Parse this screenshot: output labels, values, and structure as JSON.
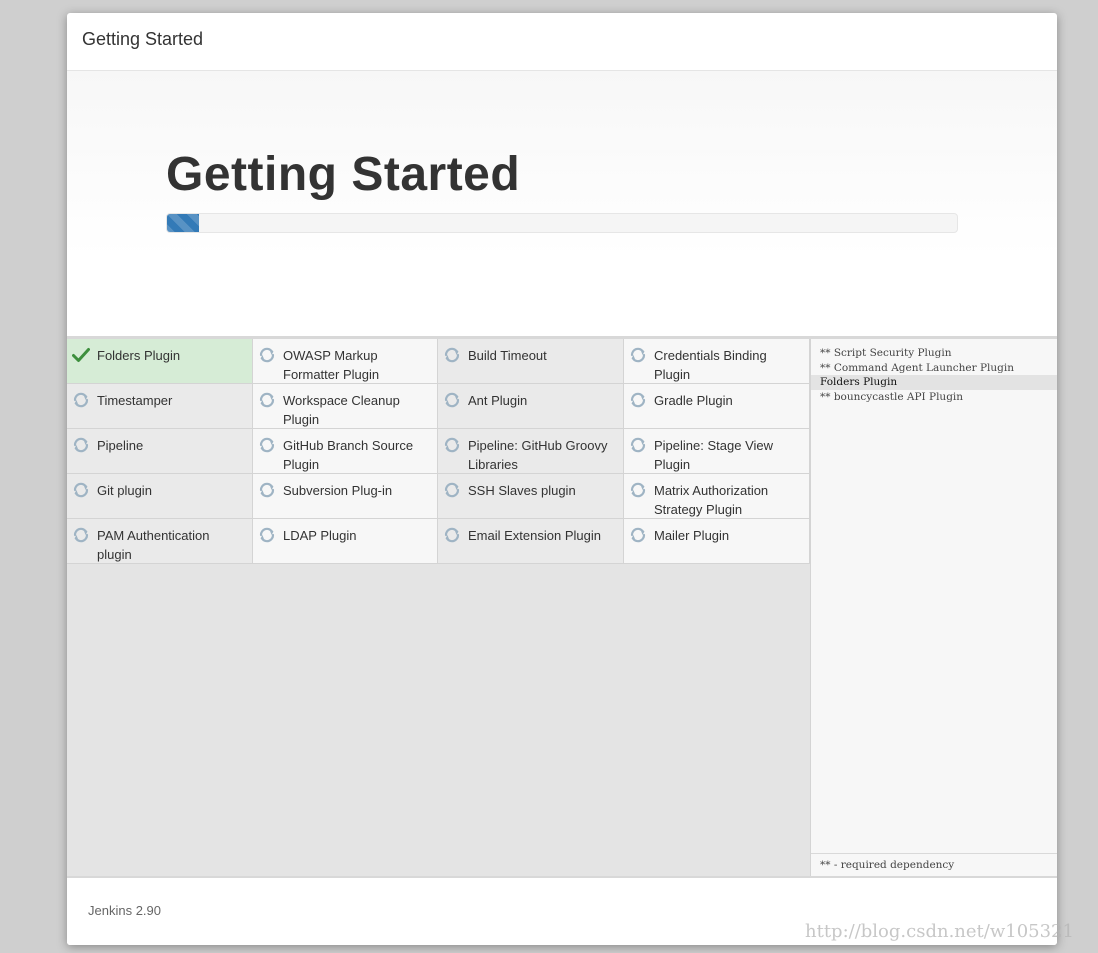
{
  "header": {
    "title": "Getting Started"
  },
  "hero": {
    "title": "Getting Started",
    "progress_percent": 4
  },
  "plugins": [
    {
      "name": "Folders Plugin",
      "status": "success"
    },
    {
      "name": "OWASP Markup Formatter Plugin",
      "status": "pending"
    },
    {
      "name": "Build Timeout",
      "status": "pending"
    },
    {
      "name": "Credentials Binding Plugin",
      "status": "pending"
    },
    {
      "name": "Timestamper",
      "status": "pending"
    },
    {
      "name": "Workspace Cleanup Plugin",
      "status": "pending"
    },
    {
      "name": "Ant Plugin",
      "status": "pending"
    },
    {
      "name": "Gradle Plugin",
      "status": "pending"
    },
    {
      "name": "Pipeline",
      "status": "pending"
    },
    {
      "name": "GitHub Branch Source Plugin",
      "status": "pending"
    },
    {
      "name": "Pipeline: GitHub Groovy Libraries",
      "status": "pending"
    },
    {
      "name": "Pipeline: Stage View Plugin",
      "status": "pending"
    },
    {
      "name": "Git plugin",
      "status": "pending"
    },
    {
      "name": "Subversion Plug-in",
      "status": "pending"
    },
    {
      "name": "SSH Slaves plugin",
      "status": "pending"
    },
    {
      "name": "Matrix Authorization Strategy Plugin",
      "status": "pending"
    },
    {
      "name": "PAM Authentication plugin",
      "status": "pending"
    },
    {
      "name": "LDAP Plugin",
      "status": "pending"
    },
    {
      "name": "Email Extension Plugin",
      "status": "pending"
    },
    {
      "name": "Mailer Plugin",
      "status": "pending"
    }
  ],
  "log": {
    "lines": [
      {
        "text": "** Script Security Plugin",
        "active": false
      },
      {
        "text": "** Command Agent Launcher Plugin",
        "active": false
      },
      {
        "text": "Folders Plugin",
        "active": true
      },
      {
        "text": "** bouncycastle API Plugin",
        "active": false
      }
    ],
    "footer": "** - required dependency"
  },
  "footer": {
    "version": "Jenkins 2.90"
  },
  "watermark": "http://blog.csdn.net/w105321",
  "colors": {
    "success_bg": "#d6ecd6",
    "check": "#3d8f3d",
    "spinner": "#9fb4c4",
    "progress": "#337ab7"
  },
  "icons": {
    "success": "check-icon",
    "pending": "refresh-icon"
  }
}
